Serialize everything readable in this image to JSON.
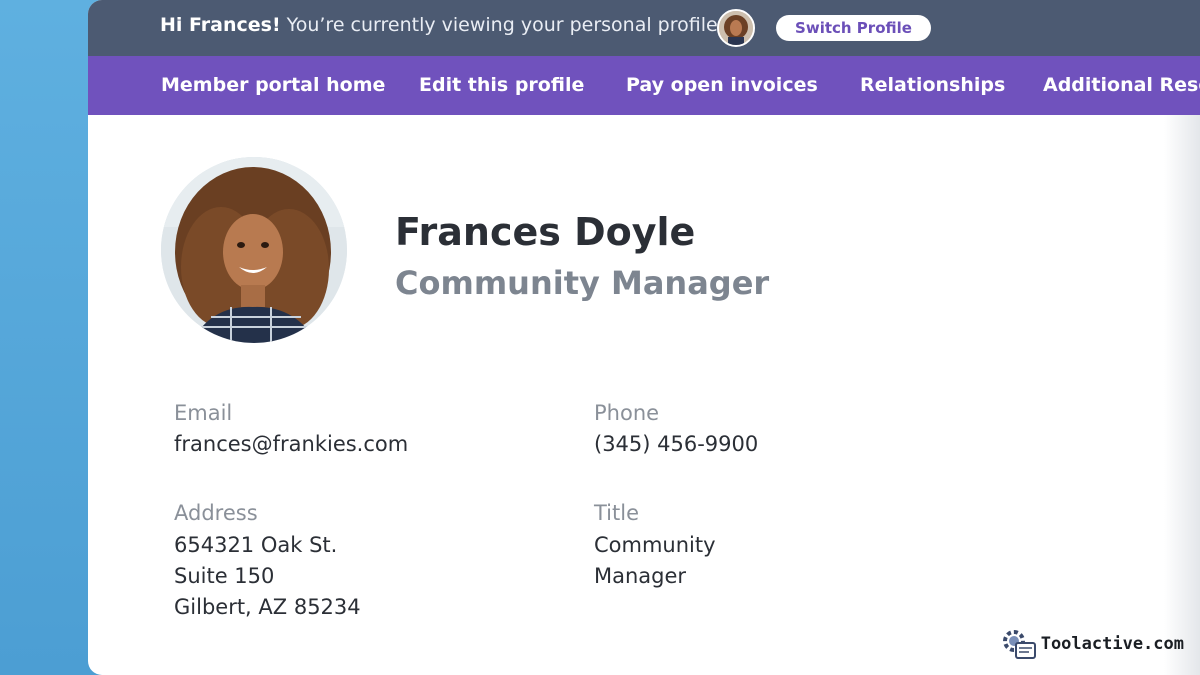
{
  "topbar": {
    "greeting_name": "Hi Frances!",
    "greeting_text": "You’re currently viewing your personal profile",
    "switch_label": "Switch Profile"
  },
  "nav": {
    "items": [
      {
        "label": "Member portal home"
      },
      {
        "label": "Edit this profile"
      },
      {
        "label": "Pay open invoices"
      },
      {
        "label": "Relationships"
      },
      {
        "label": "Additional Resou"
      }
    ]
  },
  "profile": {
    "name": "Frances Doyle",
    "role": "Community Manager"
  },
  "fields": {
    "email_label": "Email",
    "email_value": "frances@frankies.com",
    "phone_label": "Phone",
    "phone_value": "(345) 456-9900",
    "address_label": "Address",
    "address_line1": "654321 Oak St.",
    "address_line2": "Suite 150",
    "address_line3": "Gilbert, AZ 85234",
    "title_label": "Title",
    "title_line1": "Community",
    "title_line2": "Manager"
  },
  "watermark": {
    "text": "Toolactive.com"
  },
  "colors": {
    "topbar": "#4c5a72",
    "navbar": "#7052bd",
    "accent_text": "#6b4fb8",
    "background": "#5aa8d9"
  }
}
